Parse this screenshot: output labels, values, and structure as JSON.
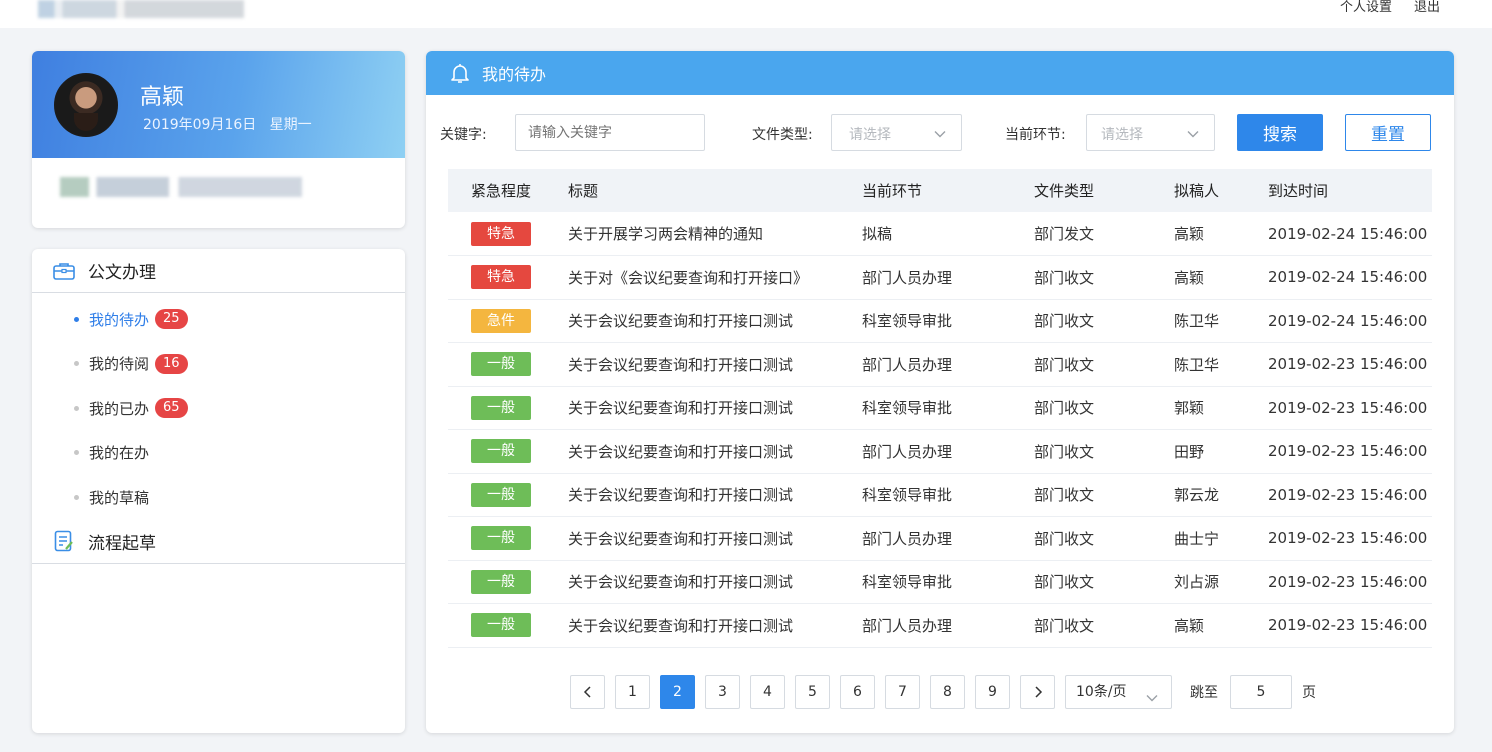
{
  "top": {
    "links": [
      "个人设置",
      "退出"
    ]
  },
  "profile": {
    "name": "高颖",
    "date": "2019年09月16日",
    "weekday": "星期一"
  },
  "menu": {
    "group1": "公文办理",
    "items": [
      {
        "label": "我的待办",
        "badge": "25",
        "active": true
      },
      {
        "label": "我的待阅",
        "badge": "16",
        "active": false
      },
      {
        "label": "我的已办",
        "badge": "65",
        "active": false
      },
      {
        "label": "我的在办",
        "badge": "",
        "active": false
      },
      {
        "label": "我的草稿",
        "badge": "",
        "active": false
      }
    ],
    "group2": "流程起草"
  },
  "panel": {
    "title": "我的待办"
  },
  "filters": {
    "keyword_label": "关键字:",
    "keyword_placeholder": "请输入关键字",
    "type_label": "文件类型:",
    "type_placeholder": "请选择",
    "step_label": "当前环节:",
    "step_placeholder": "请选择",
    "search_label": "搜索",
    "reset_label": "重置"
  },
  "table": {
    "headers": [
      "紧急程度",
      "标题",
      "当前环节",
      "文件类型",
      "拟稿人",
      "到达时间"
    ],
    "urgency_colors": {
      "特急": "#e5483f",
      "急件": "#f4b63f",
      "一般": "#6ebd58"
    },
    "rows": [
      {
        "urgency": "特急",
        "title": "关于开展学习两会精神的通知",
        "step": "拟稿",
        "type": "部门发文",
        "author": "高颖",
        "time": "2019-02-24 15:46:00"
      },
      {
        "urgency": "特急",
        "title": "关于对《会议纪要查询和打开接口》",
        "step": "部门人员办理",
        "type": "部门收文",
        "author": "高颖",
        "time": "2019-02-24 15:46:00"
      },
      {
        "urgency": "急件",
        "title": "关于会议纪要查询和打开接口测试",
        "step": "科室领导审批",
        "type": "部门收文",
        "author": "陈卫华",
        "time": "2019-02-24 15:46:00"
      },
      {
        "urgency": "一般",
        "title": "关于会议纪要查询和打开接口测试",
        "step": "部门人员办理",
        "type": "部门收文",
        "author": "陈卫华",
        "time": "2019-02-23 15:46:00"
      },
      {
        "urgency": "一般",
        "title": "关于会议纪要查询和打开接口测试",
        "step": "科室领导审批",
        "type": "部门收文",
        "author": "郭颖",
        "time": "2019-02-23 15:46:00"
      },
      {
        "urgency": "一般",
        "title": "关于会议纪要查询和打开接口测试",
        "step": "部门人员办理",
        "type": "部门收文",
        "author": "田野",
        "time": "2019-02-23 15:46:00"
      },
      {
        "urgency": "一般",
        "title": "关于会议纪要查询和打开接口测试",
        "step": "科室领导审批",
        "type": "部门收文",
        "author": "郭云龙",
        "time": "2019-02-23 15:46:00"
      },
      {
        "urgency": "一般",
        "title": "关于会议纪要查询和打开接口测试",
        "step": "部门人员办理",
        "type": "部门收文",
        "author": "曲士宁",
        "time": "2019-02-23 15:46:00"
      },
      {
        "urgency": "一般",
        "title": "关于会议纪要查询和打开接口测试",
        "step": "科室领导审批",
        "type": "部门收文",
        "author": "刘占源",
        "time": "2019-02-23 15:46:00"
      },
      {
        "urgency": "一般",
        "title": "关于会议纪要查询和打开接口测试",
        "step": "部门人员办理",
        "type": "部门收文",
        "author": "高颖",
        "time": "2019-02-23 15:46:00"
      }
    ]
  },
  "pagination": {
    "prev": "<",
    "next": ">",
    "pages": [
      "1",
      "2",
      "3",
      "4",
      "5",
      "6",
      "7",
      "8",
      "9"
    ],
    "current": "2",
    "page_size": "10条/页",
    "jump_label": "跳至",
    "jump_value": "5",
    "page_unit": "页"
  },
  "icons": {
    "bell": "bell-icon",
    "briefcase": "briefcase-icon",
    "draft": "draft-document-icon",
    "chevron": "chevron-down-icon"
  },
  "colors": {
    "primary": "#2e87ea",
    "header": "#4aa6ee",
    "badge": "#e64545"
  }
}
